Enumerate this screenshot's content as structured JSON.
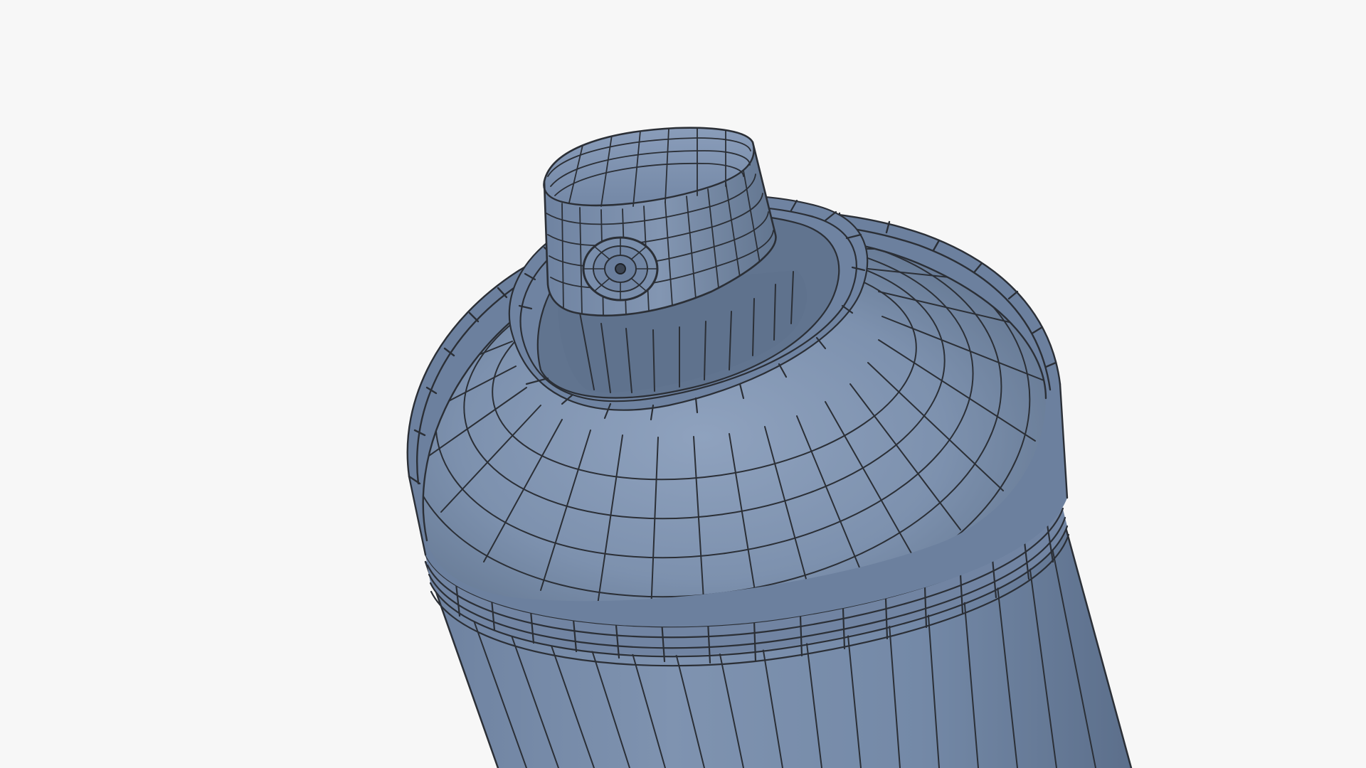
{
  "scene": {
    "subject": "spray-can-wireframe-render",
    "colors": {
      "background": "#f7f7f7",
      "surface": "#7488a6",
      "surface_light": "#90a3bf",
      "surface_dark": "#4e5f78",
      "wire": "#2b2f36"
    }
  }
}
